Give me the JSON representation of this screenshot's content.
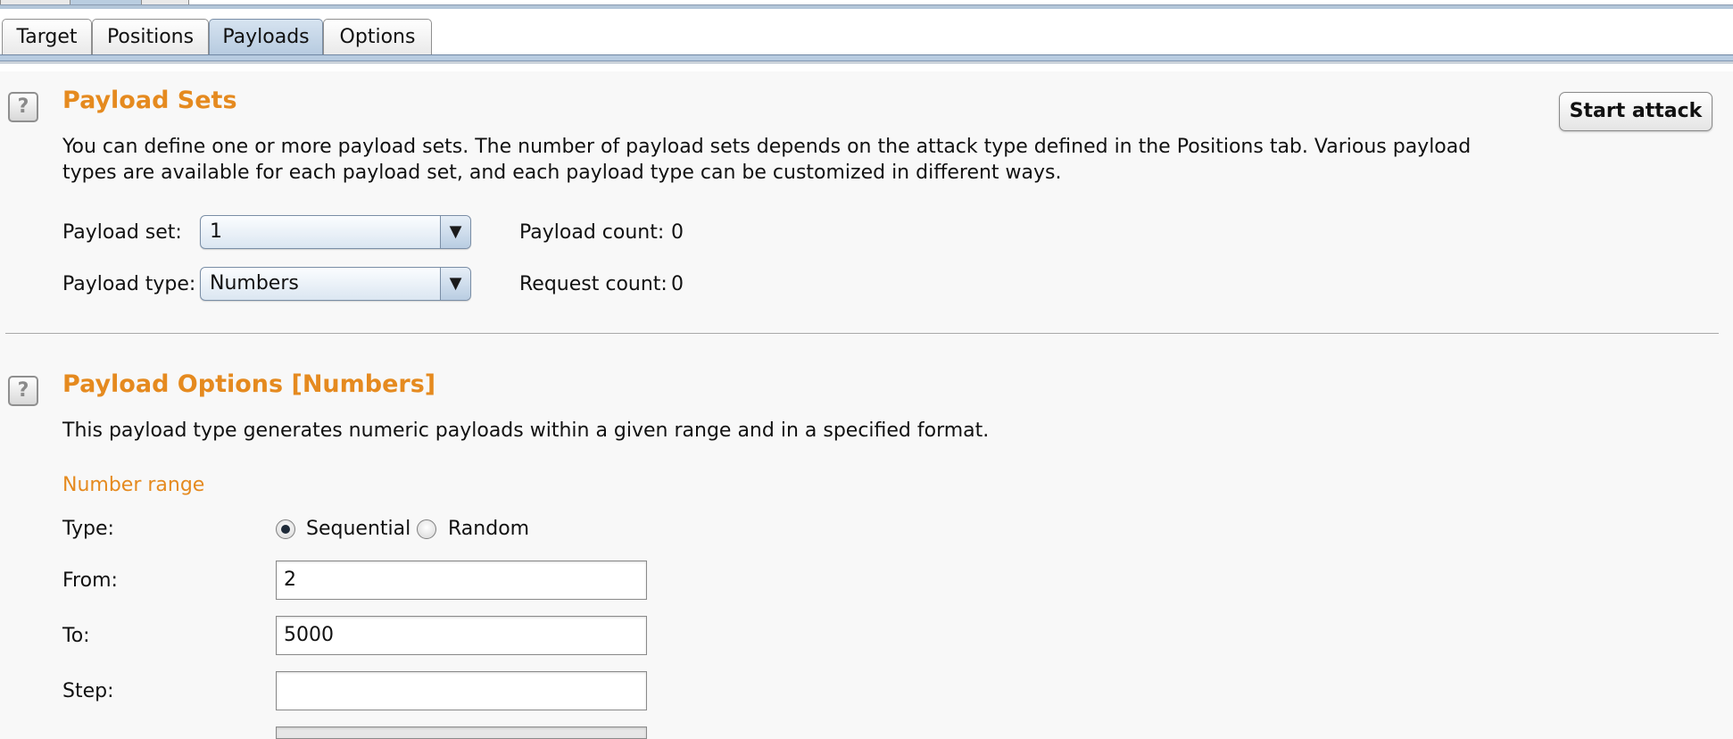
{
  "tabs": [
    "Target",
    "Positions",
    "Payloads",
    "Options"
  ],
  "active_tab": "Payloads",
  "payload_sets": {
    "help_icon": "?",
    "title": "Payload Sets",
    "description": "You can define one or more payload sets. The number of payload sets depends on the attack type defined in the Positions tab. Various payload types are available for each payload set, and each payload type can be customized in different ways.",
    "payload_set_label": "Payload set:",
    "payload_set_value": "1",
    "payload_type_label": "Payload type:",
    "payload_type_value": "Numbers",
    "payload_count_label": "Payload count:",
    "payload_count_value": "0",
    "request_count_label": "Request count:",
    "request_count_value": "0",
    "start_attack_label": "Start attack"
  },
  "payload_options": {
    "help_icon": "?",
    "title": "Payload Options [Numbers]",
    "description": "This payload type generates numeric payloads within a given range and in a specified format.",
    "number_range_heading": "Number range",
    "type_label": "Type:",
    "type_options": [
      "Sequential",
      "Random"
    ],
    "type_selected": "Sequential",
    "from_label": "From:",
    "from_value": "2",
    "to_label": "To:",
    "to_value": "5000",
    "step_label": "Step:",
    "step_value": ""
  },
  "icons": {
    "dropdown": "dropdown-arrow-icon",
    "help": "help-icon"
  },
  "colors": {
    "accent": "#e58a1f",
    "tab_active": "#b7cbe0"
  }
}
